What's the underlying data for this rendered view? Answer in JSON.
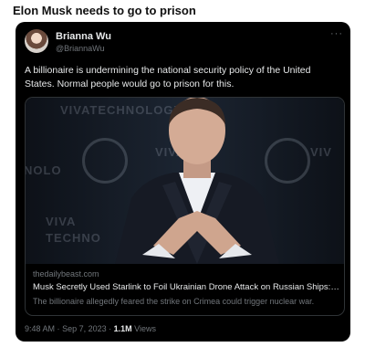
{
  "headline": "Elon Musk needs to go to prison",
  "tweet": {
    "author": "Brianna Wu",
    "handle": "@BriannaWu",
    "more_icon": "more-horizontal-icon",
    "text": "A billionaire is undermining the national security policy of the United States. Normal people would go to prison for this.",
    "time": "9:48 AM",
    "separator": "·",
    "date": "Sep 7, 2023",
    "views_count": "1.1M",
    "views_label": "Views"
  },
  "link_card": {
    "domain": "thedailybeast.com",
    "title": "Musk Secretly Used Starlink to Foil Ukrainian Drone Attack on Russian Ships: ...",
    "description": "The billionaire allegedly feared the strike on Crimea could trigger nuclear war."
  },
  "colors": {
    "tweet_background": "#000000",
    "primary_text": "#e7e9ea",
    "secondary_text": "#71767b",
    "card_border": "#2f3336"
  }
}
